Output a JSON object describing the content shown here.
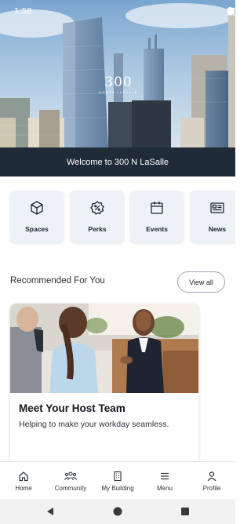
{
  "status_bar": {
    "time": "1:58"
  },
  "hero": {
    "brand_number": "300",
    "brand_subtitle": "NORTH LASALLE"
  },
  "welcome": {
    "text": "Welcome to 300 N LaSalle"
  },
  "quick_links": [
    {
      "label": "Spaces",
      "icon": "cube-icon"
    },
    {
      "label": "Perks",
      "icon": "percent-badge-icon"
    },
    {
      "label": "Events",
      "icon": "calendar-icon"
    },
    {
      "label": "News",
      "icon": "newspaper-icon"
    }
  ],
  "recommended": {
    "title": "Recommended For You",
    "view_all_label": "View all",
    "card": {
      "title": "Meet Your Host Team",
      "subtitle": "Helping to make your workday seamless."
    }
  },
  "bottom_nav": [
    {
      "label": "Home",
      "icon": "home-icon"
    },
    {
      "label": "Community",
      "icon": "community-icon"
    },
    {
      "label": "My Building",
      "icon": "building-icon"
    },
    {
      "label": "Menu",
      "icon": "menu-icon"
    },
    {
      "label": "Profile",
      "icon": "profile-icon"
    }
  ],
  "colors": {
    "dark_bar": "#1f2b36",
    "tile_bg": "#edf2f9"
  }
}
